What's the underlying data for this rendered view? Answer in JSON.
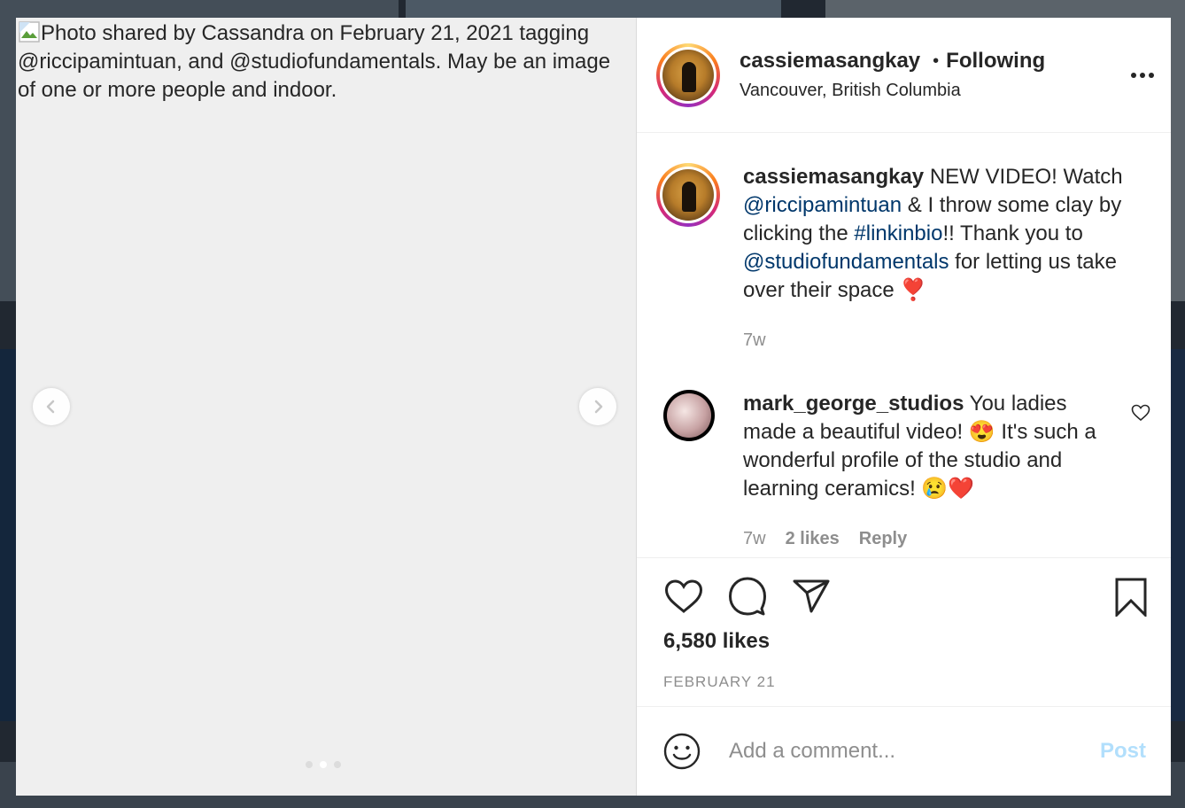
{
  "media": {
    "alt_text": "Photo shared by Cassandra on February 21, 2021 tagging @riccipamintuan, and @studiofundamentals. May be an image of one or more people and indoor.",
    "slide_count": 3,
    "active_slide": 2
  },
  "header": {
    "username": "cassiemasangkay",
    "separator": "•",
    "follow_label": "Following",
    "location": "Vancouver, British Columbia"
  },
  "caption": {
    "username": "cassiemasangkay",
    "text_1": " NEW VIDEO! Watch ",
    "mention_1": "@riccipamintuan",
    "text_2": " & I throw some clay by clicking the ",
    "hashtag": "#linkinbio",
    "text_3": "!! Thank you to ",
    "mention_2": "@studiofundamentals",
    "text_4": " for letting us take over their space ",
    "emoji": "❣️",
    "time": "7w"
  },
  "comment": {
    "username": "mark_george_studios",
    "text_1": " You ladies made a beautiful video! ",
    "emoji_1": "😍",
    "text_2": " It's such a wonderful profile of the studio and learning ceramics! ",
    "emoji_2": "😢❤️",
    "time": "7w",
    "likes": "2 likes",
    "reply": "Reply"
  },
  "actions": {
    "likes": "6,580 likes",
    "date": "FEBRUARY 21"
  },
  "add_comment": {
    "placeholder": "Add a comment...",
    "post_label": "Post"
  },
  "colors": {
    "link": "#00376b",
    "post_disabled": "#b2dffc",
    "muted": "#8e8e8e"
  }
}
